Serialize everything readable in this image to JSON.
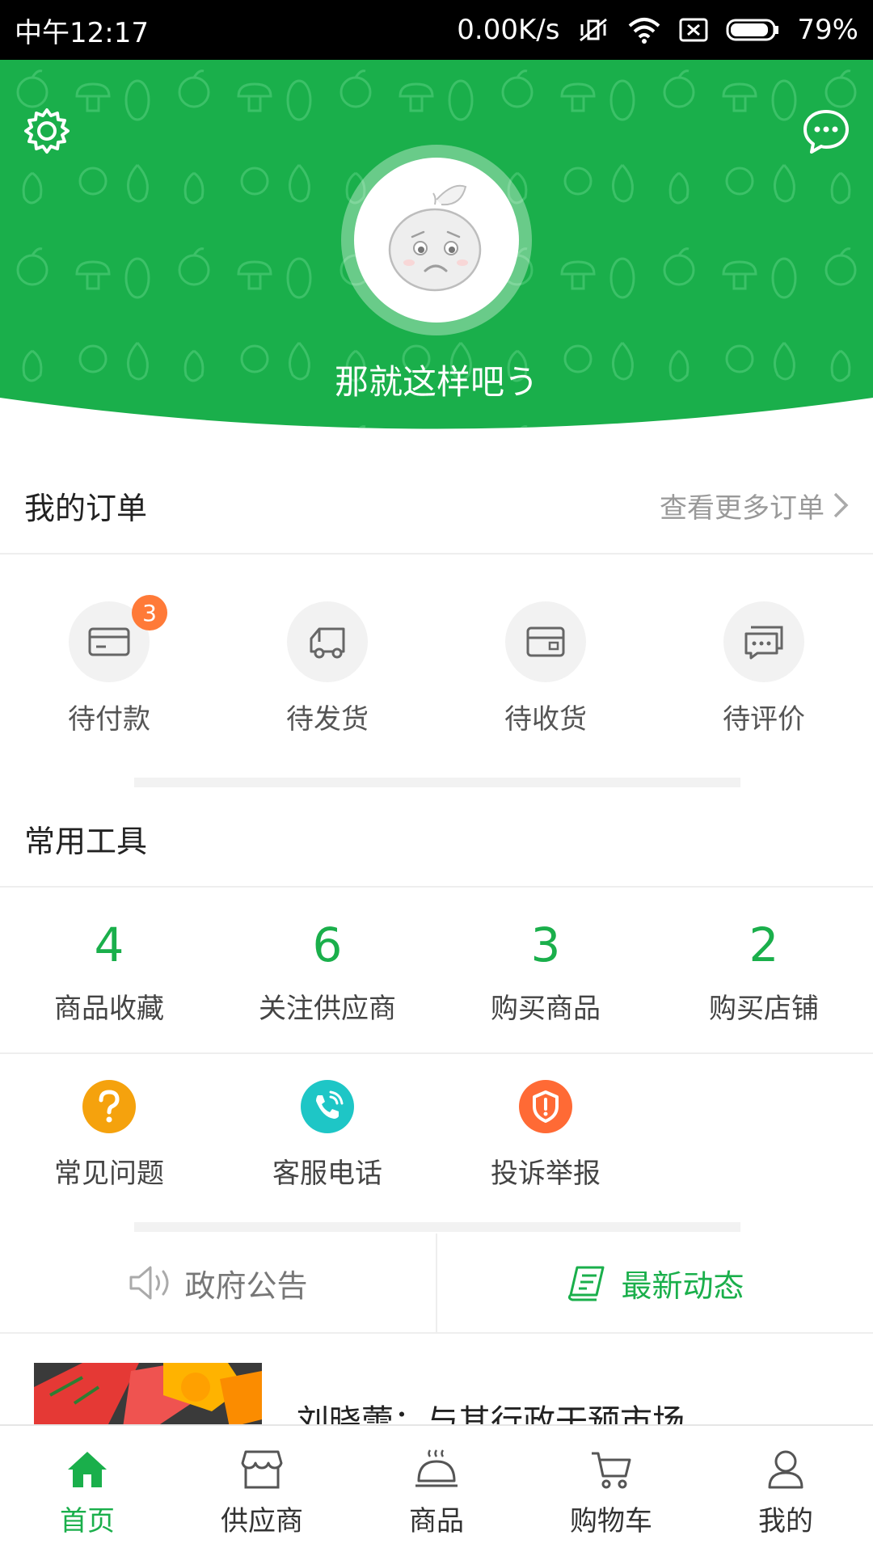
{
  "status_bar": {
    "time": "中午12:17",
    "network_speed": "0.00K/s",
    "battery": "79%"
  },
  "header": {
    "username": "那就这样吧う",
    "background_color": "#1aaf4b",
    "settings_icon": "gear-icon",
    "message_icon": "chat-bubble-icon"
  },
  "orders": {
    "title": "我的订单",
    "more_label": "查看更多订单",
    "items": [
      {
        "label": "待付款",
        "icon": "card-icon",
        "badge": "3"
      },
      {
        "label": "待发货",
        "icon": "truck-icon"
      },
      {
        "label": "待收货",
        "icon": "box-icon"
      },
      {
        "label": "待评价",
        "icon": "comment-icon"
      }
    ]
  },
  "tools": {
    "title": "常用工具",
    "stats": [
      {
        "value": "4",
        "label": "商品收藏"
      },
      {
        "value": "6",
        "label": "关注供应商"
      },
      {
        "value": "3",
        "label": "购买商品"
      },
      {
        "value": "2",
        "label": "购买店铺"
      }
    ],
    "links": [
      {
        "label": "常见问题",
        "icon": "question-icon",
        "color": "#f5a20d"
      },
      {
        "label": "客服电话",
        "icon": "phone-icon",
        "color": "#1ec6c6"
      },
      {
        "label": "投诉举报",
        "icon": "shield-icon",
        "color": "#ff6a35"
      }
    ]
  },
  "news": {
    "tab_government": "政府公告",
    "tab_latest": "最新动态",
    "article_title": "刘晓蕾：与其行政干预市场"
  },
  "tabbar": {
    "items": [
      {
        "label": "首页",
        "icon": "home-icon",
        "active": true
      },
      {
        "label": "供应商",
        "icon": "store-icon",
        "active": false
      },
      {
        "label": "商品",
        "icon": "dish-icon",
        "active": false
      },
      {
        "label": "购物车",
        "icon": "cart-icon",
        "active": false
      },
      {
        "label": "我的",
        "icon": "user-icon",
        "active": false
      }
    ]
  },
  "colors": {
    "accent": "#1aaf4b",
    "badge": "#ff7a38"
  }
}
